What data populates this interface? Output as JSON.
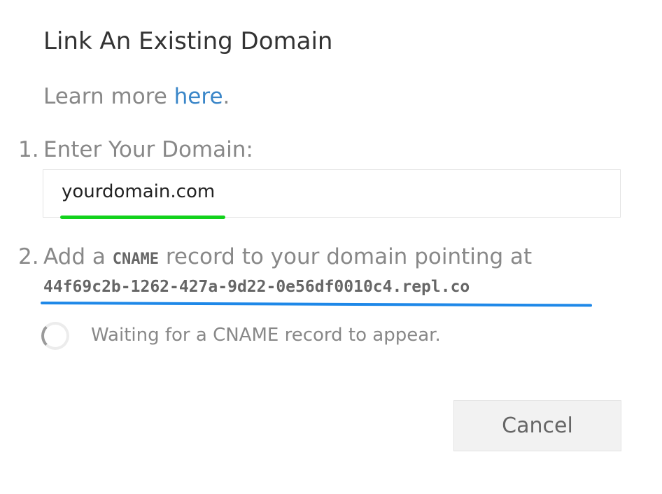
{
  "dialog": {
    "title": "Link An Existing Domain",
    "learn_more": {
      "prefix": "Learn more ",
      "link_text": "here",
      "suffix": "."
    },
    "step1": {
      "number": "1.",
      "label": "Enter Your Domain:"
    },
    "domain_input": {
      "value": "yourdomain.com",
      "placeholder": "yourdomain.com"
    },
    "step2": {
      "number": "2.",
      "label_prefix": "Add a ",
      "record_type": "CNAME",
      "label_suffix": " record to your domain pointing at",
      "target": "44f69c2b-1262-427a-9d22-0e56df0010c4.repl.co"
    },
    "status": {
      "icon": "loading-spinner-icon",
      "text": "Waiting for a CNAME record to appear."
    },
    "cancel_label": "Cancel"
  },
  "colors": {
    "link": "#3a86c8",
    "input_highlight": "#12d21c",
    "target_highlight": "#1e88e8",
    "button_bg": "#f2f2f2"
  }
}
